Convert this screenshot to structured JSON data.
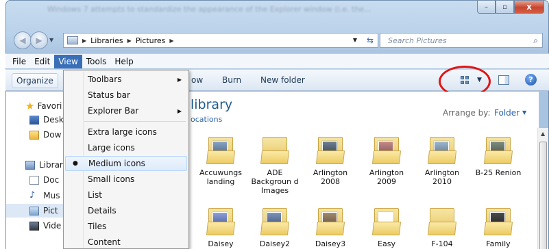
{
  "window": {
    "blurred_text": "Windows 7 attempts to standardize the appearance of the Explorer window (i.e. the...",
    "caption": {
      "minimize": "–",
      "maximize": "▫",
      "close": "x"
    }
  },
  "address": {
    "crumbs": [
      "Libraries",
      "Pictures"
    ],
    "search_placeholder": "Search Pictures"
  },
  "menubar": {
    "items": [
      "File",
      "Edit",
      "View",
      "Tools",
      "Help"
    ],
    "active": "View"
  },
  "commandbar": {
    "organize": "Organize",
    "show": "ow",
    "burn": "Burn",
    "new_folder": "New folder",
    "help": "?"
  },
  "navpane": {
    "favorites": "Favori",
    "desktop": "Desk",
    "downloads": "Dow",
    "libraries": "Librar",
    "documents": "Doc",
    "music": "Mus",
    "pictures": "Pict",
    "videos": "Vide"
  },
  "content": {
    "title": "library",
    "subtitle": "ocations",
    "arrange_label": "Arrange by:",
    "arrange_value": "Folder",
    "folders_row1": [
      "Accuwungs landing",
      "ADE Backgroun d Images",
      "Arlington 2008",
      "Arlington 2009",
      "Arlington 2010",
      "B-25 Renion"
    ],
    "folders_row2": [
      "Daisey",
      "Daisey2",
      "Daisey3",
      "Easy",
      "F-104",
      "Family"
    ]
  },
  "view_menu": {
    "items": [
      {
        "label": "Toolbars",
        "submenu": true
      },
      {
        "label": "Status bar"
      },
      {
        "label": "Explorer Bar",
        "submenu": true
      },
      {
        "label": "Extra large icons"
      },
      {
        "label": "Large icons"
      },
      {
        "label": "Medium icons",
        "selected": true
      },
      {
        "label": "Small icons"
      },
      {
        "label": "List"
      },
      {
        "label": "Details"
      },
      {
        "label": "Tiles"
      },
      {
        "label": "Content"
      }
    ]
  },
  "colors": {
    "accent": "#3a6fb8",
    "annotation_circle": "#e01414",
    "link": "#2d64a8"
  }
}
